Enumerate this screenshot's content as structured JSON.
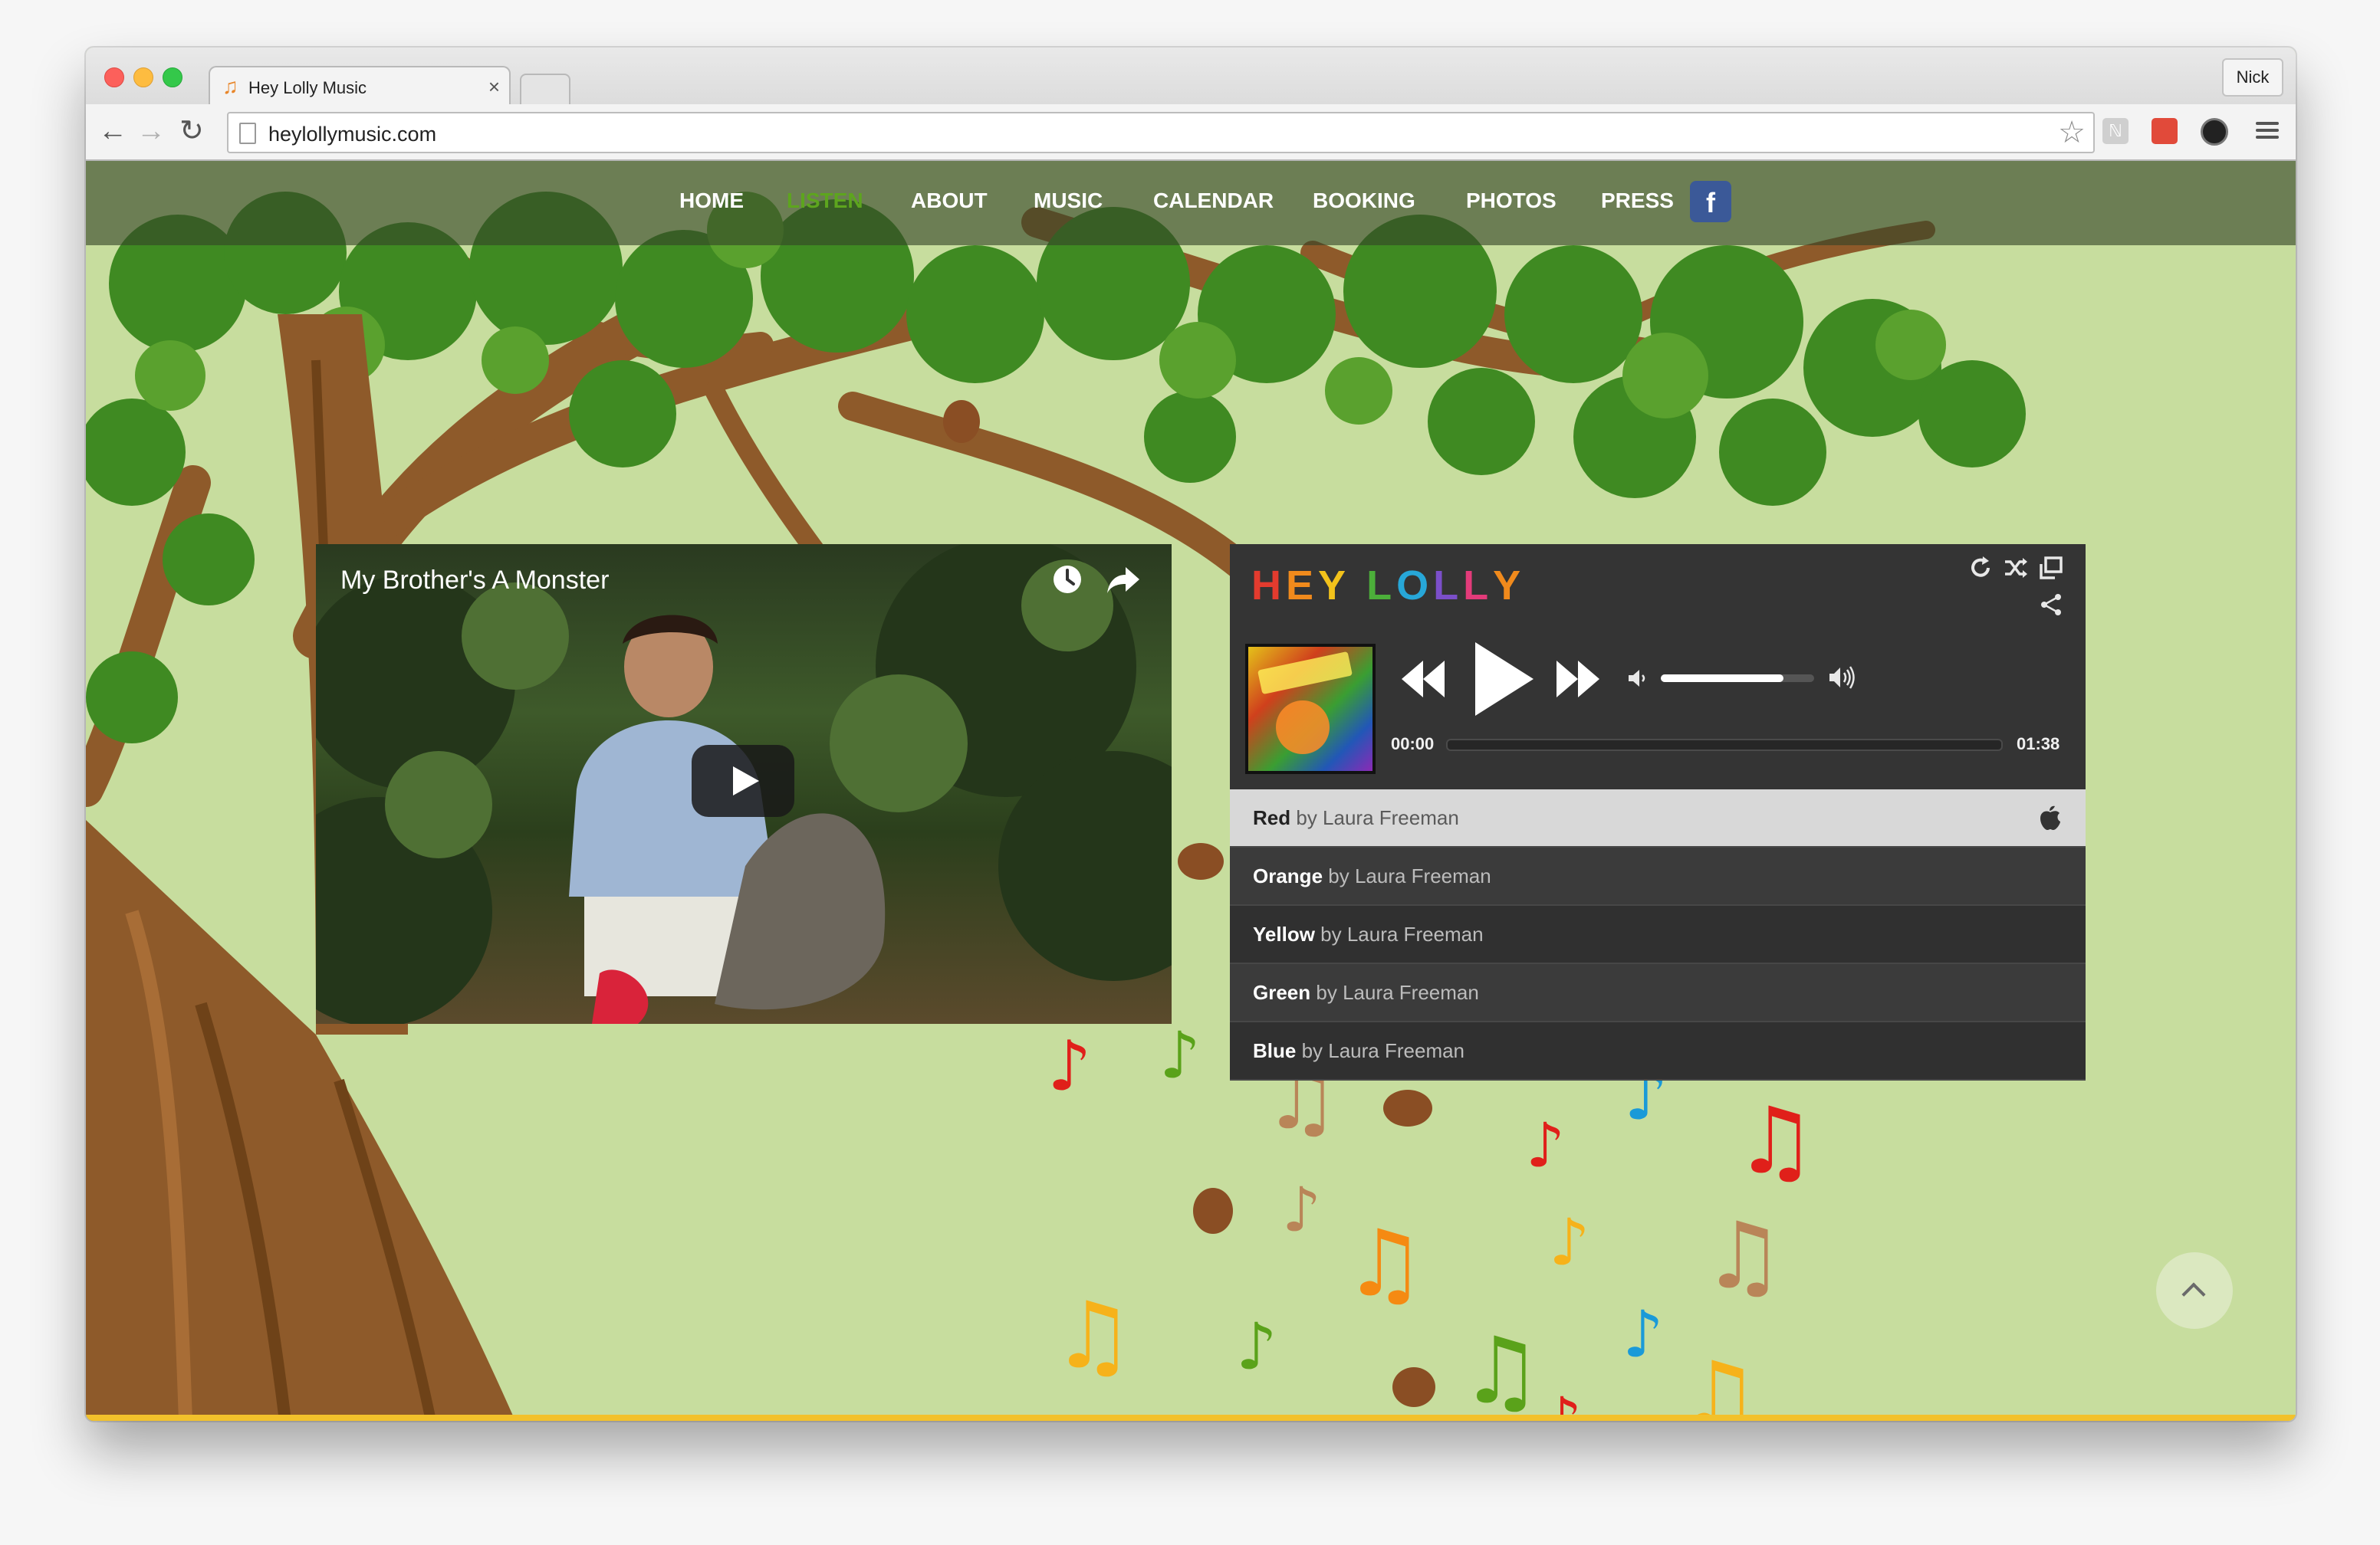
{
  "browser": {
    "tab_title": "Hey Lolly Music",
    "tab_close": "×",
    "profile_name": "Nick",
    "url": "heylollymusic.com",
    "back_icon": "←",
    "forward_icon": "→",
    "reload_icon": "↻",
    "star_icon": "☆"
  },
  "nav": {
    "items": [
      {
        "label": "HOME",
        "active": false
      },
      {
        "label": "LISTEN",
        "active": true
      },
      {
        "label": "ABOUT",
        "active": false
      },
      {
        "label": "MUSIC",
        "active": false
      },
      {
        "label": "CALENDAR",
        "active": false
      },
      {
        "label": "BOOKING",
        "active": false
      },
      {
        "label": "PHOTOS",
        "active": false
      },
      {
        "label": "PRESS",
        "active": false
      }
    ],
    "facebook_label": "f",
    "active_color": "#5da51e"
  },
  "video": {
    "title": "My Brother's A Monster"
  },
  "player": {
    "logo_letters": [
      {
        "ch": "H",
        "color": "#e33b2e"
      },
      {
        "ch": "E",
        "color": "#f08a1c"
      },
      {
        "ch": "Y",
        "color": "#f2c21b"
      },
      {
        "ch": " ",
        "color": "#ffffff"
      },
      {
        "ch": "L",
        "color": "#4caf3a"
      },
      {
        "ch": "O",
        "color": "#27a7d8"
      },
      {
        "ch": "L",
        "color": "#7b4fc9"
      },
      {
        "ch": "L",
        "color": "#e33b7a"
      },
      {
        "ch": "Y",
        "color": "#f08a1c"
      }
    ],
    "time_current": "00:00",
    "time_total": "01:38",
    "volume_fraction": 0.8,
    "progress_fraction": 0.0,
    "icons": [
      "refresh-icon",
      "shuffle-icon",
      "popout-icon",
      "share-icon"
    ],
    "tracks": [
      {
        "title": "Red",
        "by": "by Laura Freeman",
        "current": true
      },
      {
        "title": "Orange",
        "by": "by Laura Freeman",
        "current": false
      },
      {
        "title": "Yellow",
        "by": "by Laura Freeman",
        "current": false
      },
      {
        "title": "Green",
        "by": "by Laura Freeman",
        "current": false
      },
      {
        "title": "Blue",
        "by": "by Laura Freeman",
        "current": false
      }
    ]
  },
  "colors": {
    "page_bg": "#c7dd9e",
    "trunk": "#8e5a2a",
    "leaf": "#3f8a22",
    "note_red": "#e0201a",
    "note_orange": "#f58a12",
    "note_yellow": "#f6b21a",
    "note_green": "#5aa21a",
    "note_blue": "#1a9ad8",
    "note_brown": "#b98558"
  }
}
